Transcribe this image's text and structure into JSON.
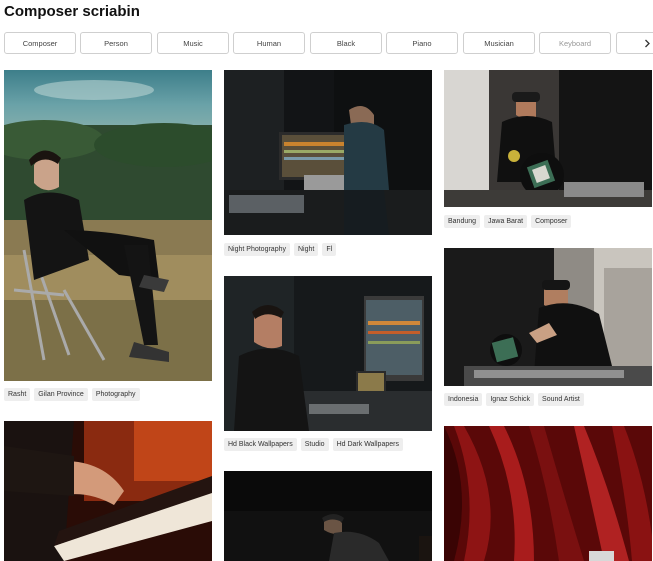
{
  "page": {
    "title": "Composer scriabin"
  },
  "chips": [
    "Composer",
    "Person",
    "Music",
    "Human",
    "Black",
    "Piano",
    "Musician",
    "Keyboard"
  ],
  "columns": [
    {
      "photos": [
        {
          "alt": "Man sitting on a folding chair by a lake",
          "tags": [
            "Rasht",
            "Gilan Province",
            "Photography"
          ]
        },
        {
          "alt": "Hands playing a piano in warm light",
          "tags": []
        }
      ]
    },
    {
      "photos": [
        {
          "alt": "Producer at a studio desk with monitor",
          "tags": [
            "Night Photography",
            "Night",
            "Fl"
          ]
        },
        {
          "alt": "Man working at a computer in a studio",
          "tags": [
            "Hd Black Wallpapers",
            "Studio",
            "Hd Dark Wallpapers"
          ]
        },
        {
          "alt": "DJ at turntables in the dark",
          "tags": []
        }
      ]
    },
    {
      "photos": [
        {
          "alt": "DJ holding a vinyl record",
          "tags": [
            "Bandung",
            "Jawa Barat",
            "Composer"
          ]
        },
        {
          "alt": "DJ with vinyl at turntables",
          "tags": [
            "Indonesia",
            "Ignaz Schick",
            "Sound Artist"
          ]
        },
        {
          "alt": "Red theater curtain",
          "tags": []
        }
      ]
    }
  ],
  "colors": {
    "chip_border": "#cfcfcf",
    "tag_bg": "#eeeeee",
    "title": "#111111"
  }
}
